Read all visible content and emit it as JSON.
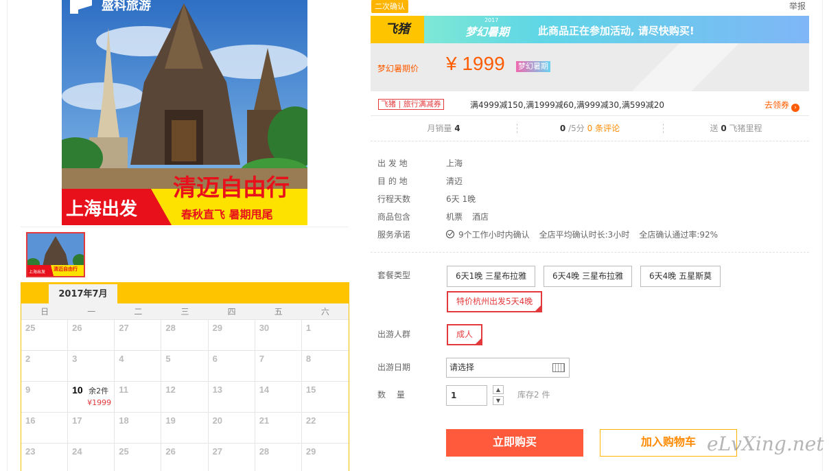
{
  "main_image": {
    "brand": "盛科旅游",
    "headline": "清迈自由行",
    "origin": "上海出发",
    "tagline": "春秋直飞 暑期甩尾"
  },
  "thumbnail": {
    "headline": "清迈自由行",
    "origin": "上海出发"
  },
  "calendar": {
    "month_label": "2017年7月",
    "weekdays": [
      "日",
      "一",
      "二",
      "三",
      "四",
      "五",
      "六"
    ],
    "active_day": {
      "day": "10",
      "stock": "余2件",
      "price": "¥1999"
    }
  },
  "top": {
    "confirm_badge": "二次确认",
    "report": "举报"
  },
  "promo": {
    "logo": "飞猪",
    "year": "2017",
    "campaign": "梦幻暑期",
    "text": "此商品正在参加活动, 请尽快购买!"
  },
  "price": {
    "label": "梦幻暑期价",
    "value": "¥ 1999",
    "tag": "梦幻暑期"
  },
  "coupon": {
    "badge": "飞猪 | 旅行满减券",
    "rules": "满4999减150,满1999减60,满999减30,满599减20",
    "link": "去领券",
    "link_icon": "›"
  },
  "stats": {
    "sales_label": "月销量",
    "sales_value": "4",
    "rating_value": "0",
    "rating_suffix": "/5分",
    "reviews": "0 条评论",
    "miles_prefix": "送",
    "miles_value": "0",
    "miles_suffix": "飞猪里程"
  },
  "info": {
    "departure_label": "出 发 地",
    "departure": "上海",
    "destination_label": "目 的 地",
    "destination": "清迈",
    "duration_label": "行程天数",
    "duration": "6天 1晚",
    "includes_label": "商品包含",
    "includes_1": "机票",
    "includes_2": "酒店",
    "service_label": "服务承诺",
    "service_1": "9个工作小时内确认",
    "service_2": "全店平均确认时长:3小时",
    "service_3": "全店确认通过率:92%"
  },
  "options": {
    "package_label": "套餐类型",
    "packages": [
      "6天1晚 三星布拉雅",
      "6天4晚 三星布拉雅",
      "6天4晚 五星斯莫",
      "特价杭州出发5天4晚"
    ],
    "traveler_label": "出游人群",
    "traveler": "成人",
    "date_label": "出游日期",
    "date_placeholder": "请选择",
    "qty_label": "数　 量",
    "qty_value": "1",
    "qty_up": "▲",
    "qty_down": "▼",
    "stock": "库存2 件"
  },
  "actions": {
    "buy": "立即购买",
    "cart": "加入购物车"
  },
  "watermark": "eLvXing.net"
}
